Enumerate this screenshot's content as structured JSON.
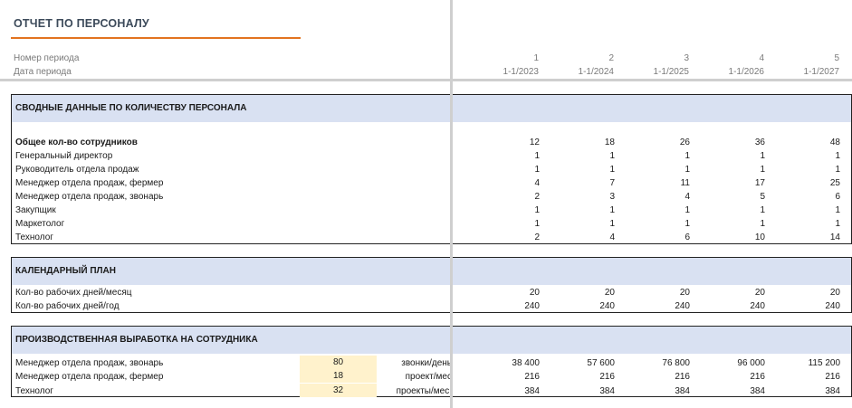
{
  "report": {
    "title": "ОТЧЕТ ПО ПЕРСОНАЛУ"
  },
  "header": {
    "period_number_label": "Номер периода",
    "period_date_label": "Дата периода",
    "period_numbers": [
      "1",
      "2",
      "3",
      "4",
      "5"
    ],
    "period_dates": [
      "1-1/2023",
      "1-1/2024",
      "1-1/2025",
      "1-1/2026",
      "1-1/2027"
    ]
  },
  "headcount": {
    "title": "СВОДНЫЕ ДАННЫЕ ПО КОЛИЧЕСТВУ ПЕРСОНАЛА",
    "rows": [
      {
        "label": "Общее кол-во сотрудников",
        "values": [
          "12",
          "18",
          "26",
          "36",
          "48"
        ]
      },
      {
        "label": "Генеральный директор",
        "values": [
          "1",
          "1",
          "1",
          "1",
          "1"
        ]
      },
      {
        "label": "Руководитель отдела продаж",
        "values": [
          "1",
          "1",
          "1",
          "1",
          "1"
        ]
      },
      {
        "label": "Менеджер отдела продаж, фермер",
        "values": [
          "4",
          "7",
          "11",
          "17",
          "25"
        ]
      },
      {
        "label": "Менеджер отдела продаж, звонарь",
        "values": [
          "2",
          "3",
          "4",
          "5",
          "6"
        ]
      },
      {
        "label": "Закупщик",
        "values": [
          "1",
          "1",
          "1",
          "1",
          "1"
        ]
      },
      {
        "label": "Маркетолог",
        "values": [
          "1",
          "1",
          "1",
          "1",
          "1"
        ]
      },
      {
        "label": "Технолог",
        "values": [
          "2",
          "4",
          "6",
          "10",
          "14"
        ]
      }
    ]
  },
  "calendar": {
    "title": "КАЛЕНДАРНЫЙ ПЛАН",
    "rows": [
      {
        "label": "Кол-во рабочих дней/месяц",
        "values": [
          "20",
          "20",
          "20",
          "20",
          "20"
        ]
      },
      {
        "label": "Кол-во рабочих дней/год",
        "values": [
          "240",
          "240",
          "240",
          "240",
          "240"
        ]
      }
    ]
  },
  "productivity": {
    "title": "ПРОИЗВОДСТВЕННАЯ ВЫРАБОТКА НА СОТРУДНИКА",
    "rows": [
      {
        "label": "Менеджер отдела продаж, звонарь",
        "input": "80",
        "unit": "звонки/день",
        "values": [
          "38 400",
          "57 600",
          "76 800",
          "96 000",
          "115 200"
        ]
      },
      {
        "label": "Менеджер отдела продаж, фермер",
        "input": "18",
        "unit": "проект/мес",
        "values": [
          "216",
          "216",
          "216",
          "216",
          "216"
        ]
      },
      {
        "label": "Технолог",
        "input": "32",
        "unit": "проекты/мес.",
        "values": [
          "384",
          "384",
          "384",
          "384",
          "384"
        ]
      }
    ]
  },
  "colors": {
    "accent_line": "#e2731f",
    "section_band": "#d9e1f2",
    "input_fill": "#fff2cc"
  }
}
